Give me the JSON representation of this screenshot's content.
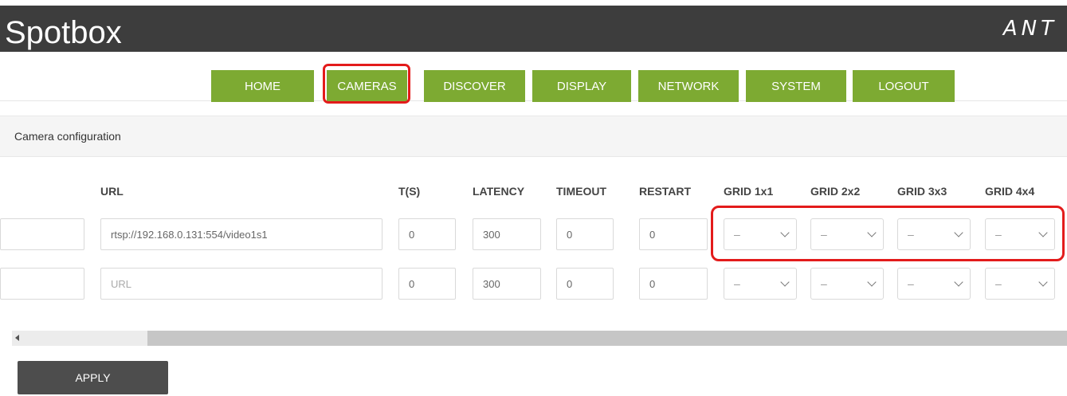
{
  "header": {
    "title": "Spotbox",
    "brand": "ANT"
  },
  "nav": {
    "tabs": [
      "HOME",
      "CAMERAS",
      "DISCOVER",
      "DISPLAY",
      "NETWORK",
      "SYSTEM",
      "LOGOUT"
    ],
    "active": "CAMERAS"
  },
  "section": {
    "title": "Camera configuration"
  },
  "table": {
    "columns": [
      "URL",
      "T(S)",
      "LATENCY",
      "TIMEOUT",
      "RESTART",
      "GRID 1x1",
      "GRID 2x2",
      "GRID 3x3",
      "GRID 4x4"
    ],
    "rows": [
      {
        "url": "rtsp://192.168.0.131:554/video1s1",
        "t": "0",
        "latency": "300",
        "timeout": "0",
        "restart": "0",
        "grid1": "–",
        "grid2": "–",
        "grid3": "–",
        "grid4": "–"
      },
      {
        "url_placeholder": "URL",
        "t": "0",
        "latency": "300",
        "timeout": "0",
        "restart": "0",
        "grid1": "–",
        "grid2": "–",
        "grid3": "–",
        "grid4": "–"
      }
    ]
  },
  "actions": {
    "apply": "APPLY"
  },
  "colors": {
    "header_bg": "#3d3d3d",
    "tab_green": "#7daa32",
    "highlight_red": "#e31b1b",
    "apply_bg": "#4d4d4d"
  }
}
